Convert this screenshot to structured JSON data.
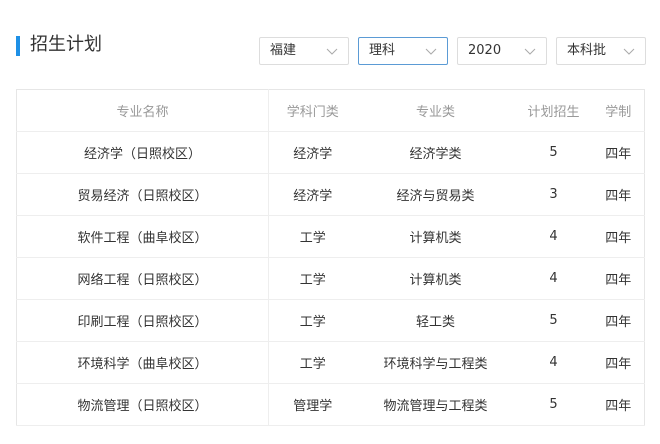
{
  "header": {
    "title": "招生计划"
  },
  "filters": [
    {
      "value": "福建",
      "icon": "chevron-down-icon"
    },
    {
      "value": "理科",
      "icon": "chevron-down-icon"
    },
    {
      "value": "2020",
      "icon": "chevron-down-icon"
    },
    {
      "value": "本科批",
      "icon": "chevron-down-icon"
    }
  ],
  "table": {
    "headers": [
      "专业名称",
      "学科门类",
      "专业类",
      "计划招生",
      "学制"
    ],
    "rows": [
      [
        "经济学（日照校区）",
        "经济学",
        "经济学类",
        "5",
        "四年"
      ],
      [
        "贸易经济（日照校区）",
        "经济学",
        "经济与贸易类",
        "3",
        "四年"
      ],
      [
        "软件工程（曲阜校区）",
        "工学",
        "计算机类",
        "4",
        "四年"
      ],
      [
        "网络工程（日照校区）",
        "工学",
        "计算机类",
        "4",
        "四年"
      ],
      [
        "印刷工程（日照校区）",
        "工学",
        "轻工类",
        "5",
        "四年"
      ],
      [
        "环境科学（曲阜校区）",
        "工学",
        "环境科学与工程类",
        "4",
        "四年"
      ],
      [
        "物流管理（日照校区）",
        "管理学",
        "物流管理与工程类",
        "5",
        "四年"
      ]
    ]
  },
  "colors": {
    "accent": "#1e90e6",
    "active_border": "#5b9bd5",
    "header_text": "#999999"
  }
}
